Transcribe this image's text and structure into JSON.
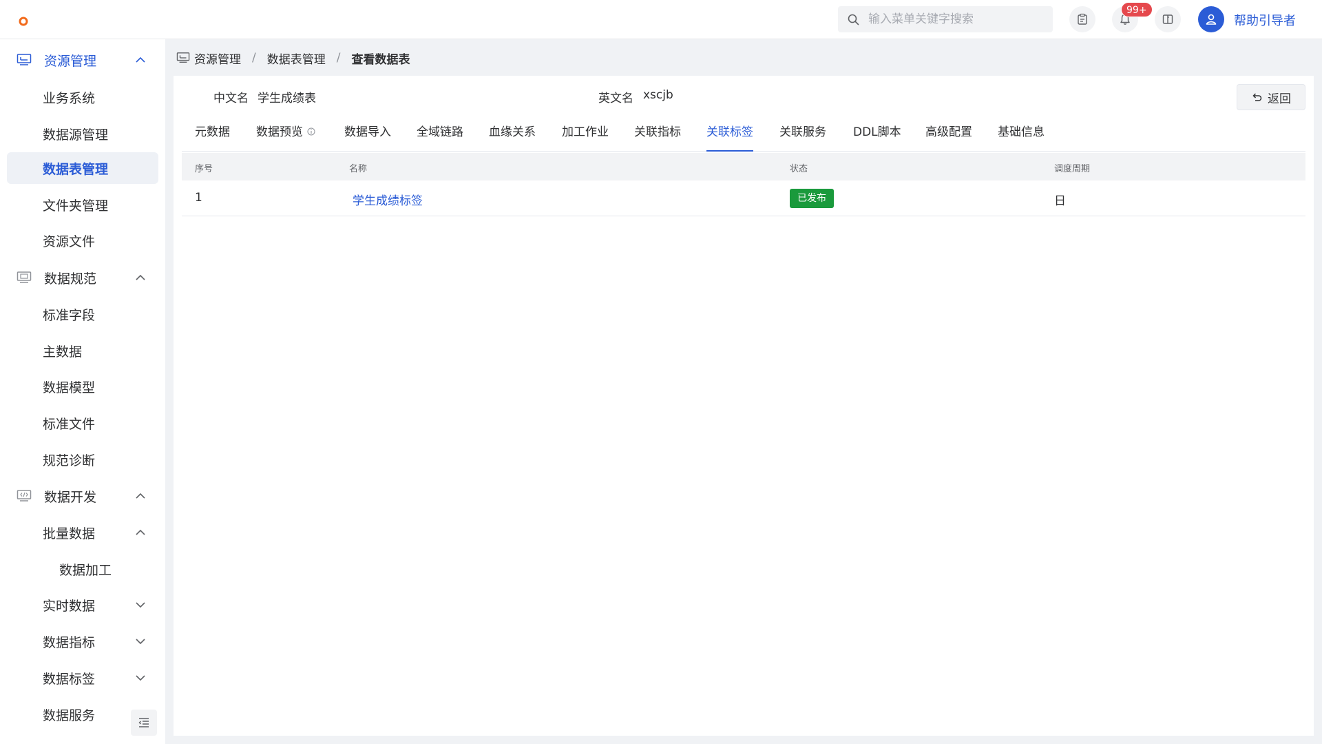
{
  "header": {
    "search_placeholder": "输入菜单关键字搜索",
    "notification_count": "99+",
    "username": "帮助引导者",
    "brand_color": "#2b5cd6"
  },
  "sidebar": {
    "items": [
      {
        "label": "资源管理",
        "type": "group",
        "expanded": true,
        "icon": "desktop-icon"
      },
      {
        "label": "业务系统",
        "type": "sub"
      },
      {
        "label": "数据源管理",
        "type": "sub"
      },
      {
        "label": "数据表管理",
        "type": "sub",
        "selected": true
      },
      {
        "label": "文件夹管理",
        "type": "sub"
      },
      {
        "label": "资源文件",
        "type": "sub"
      },
      {
        "label": "数据规范",
        "type": "group",
        "expanded": true,
        "icon": "monitor-icon"
      },
      {
        "label": "标准字段",
        "type": "sub"
      },
      {
        "label": "主数据",
        "type": "sub"
      },
      {
        "label": "数据模型",
        "type": "sub"
      },
      {
        "label": "标准文件",
        "type": "sub"
      },
      {
        "label": "规范诊断",
        "type": "sub"
      },
      {
        "label": "数据开发",
        "type": "group",
        "expanded": true,
        "icon": "code-icon"
      },
      {
        "label": "批量数据",
        "type": "sub",
        "expanded": true
      },
      {
        "label": "数据加工",
        "type": "sub2"
      },
      {
        "label": "实时数据",
        "type": "sub",
        "expanded": false
      },
      {
        "label": "数据指标",
        "type": "sub",
        "expanded": false
      },
      {
        "label": "数据标签",
        "type": "sub",
        "expanded": false
      },
      {
        "label": "数据服务",
        "type": "sub"
      }
    ]
  },
  "breadcrumb": {
    "items": [
      "资源管理",
      "数据表管理",
      "查看数据表"
    ]
  },
  "detail": {
    "cn_name_label": "中文名",
    "cn_name_value": "学生成绩表",
    "en_name_label": "英文名",
    "en_name_value": "xscjb",
    "back_label": "返回"
  },
  "tabs": [
    "元数据",
    "数据预览",
    "数据导入",
    "全域链路",
    "血缘关系",
    "加工作业",
    "关联指标",
    "关联标签",
    "关联服务",
    "DDL脚本",
    "高级配置",
    "基础信息"
  ],
  "active_tab": "关联标签",
  "table": {
    "columns": [
      "序号",
      "名称",
      "状态",
      "调度周期"
    ],
    "rows": [
      {
        "index": "1",
        "name": "学生成绩标签",
        "status": "已发布",
        "cycle": "日"
      }
    ],
    "status_color": "#1a9a3c"
  }
}
